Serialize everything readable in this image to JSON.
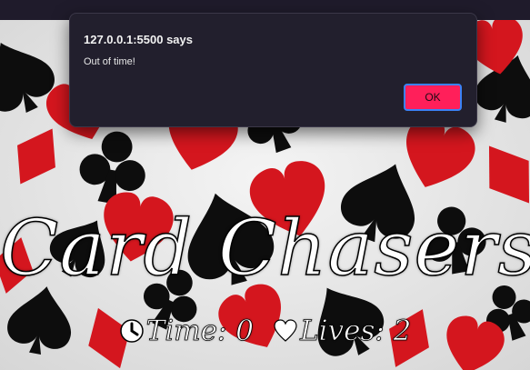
{
  "dialog": {
    "title": "127.0.0.1:5500 says",
    "message": "Out of time!",
    "ok_label": "OK",
    "accent_color": "#ff1f5a"
  },
  "game": {
    "title": "Card Chasers",
    "time_label": "Time: 0",
    "lives_label": "Lives: 2",
    "time_icon": "clock-icon",
    "lives_icon": "heart-icon"
  },
  "colors": {
    "topbar": "#1f1b2b",
    "dialog_background": "#221f2d",
    "red_suit": "#d4161e",
    "black_suit": "#0d0d0d"
  }
}
